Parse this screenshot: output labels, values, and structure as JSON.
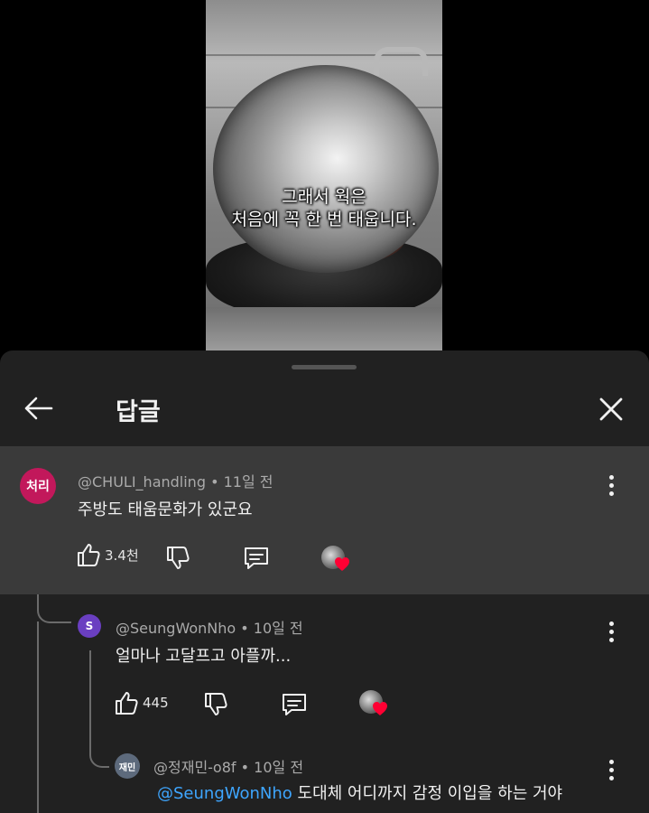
{
  "video": {
    "subtitle_line1": "그래서 웍은",
    "subtitle_line2": "처음에 꼭 한 번 태웁니다."
  },
  "sheet": {
    "title": "답글"
  },
  "comments": [
    {
      "avatar_text": "처리",
      "author": "@CHULI_handling",
      "time": "11일 전",
      "text": "주방도 태움문화가 있군요",
      "likes": "3.4천"
    },
    {
      "avatar_text": "S",
      "author": "@SeungWonNho",
      "time": "10일 전",
      "text": "얼마나 고달프고 아플까...",
      "likes": "445"
    },
    {
      "avatar_text": "재민",
      "author": "@정재민-o8f",
      "time": "10일 전",
      "mention": "@SeungWonNho",
      "text": "도대체 어디까지 감정 이입을 하는 거야"
    }
  ],
  "separator": " • ",
  "colors": {
    "background": "#000000",
    "sheet": "#212121",
    "highlighted_comment": "#3a3a3a",
    "mention": "#3ea6ff",
    "heart": "#ff0033"
  },
  "icons": [
    "back-arrow-icon",
    "close-icon",
    "thumbs-up-icon",
    "thumbs-down-icon",
    "reply-icon",
    "more-vert-icon",
    "heart-icon"
  ]
}
